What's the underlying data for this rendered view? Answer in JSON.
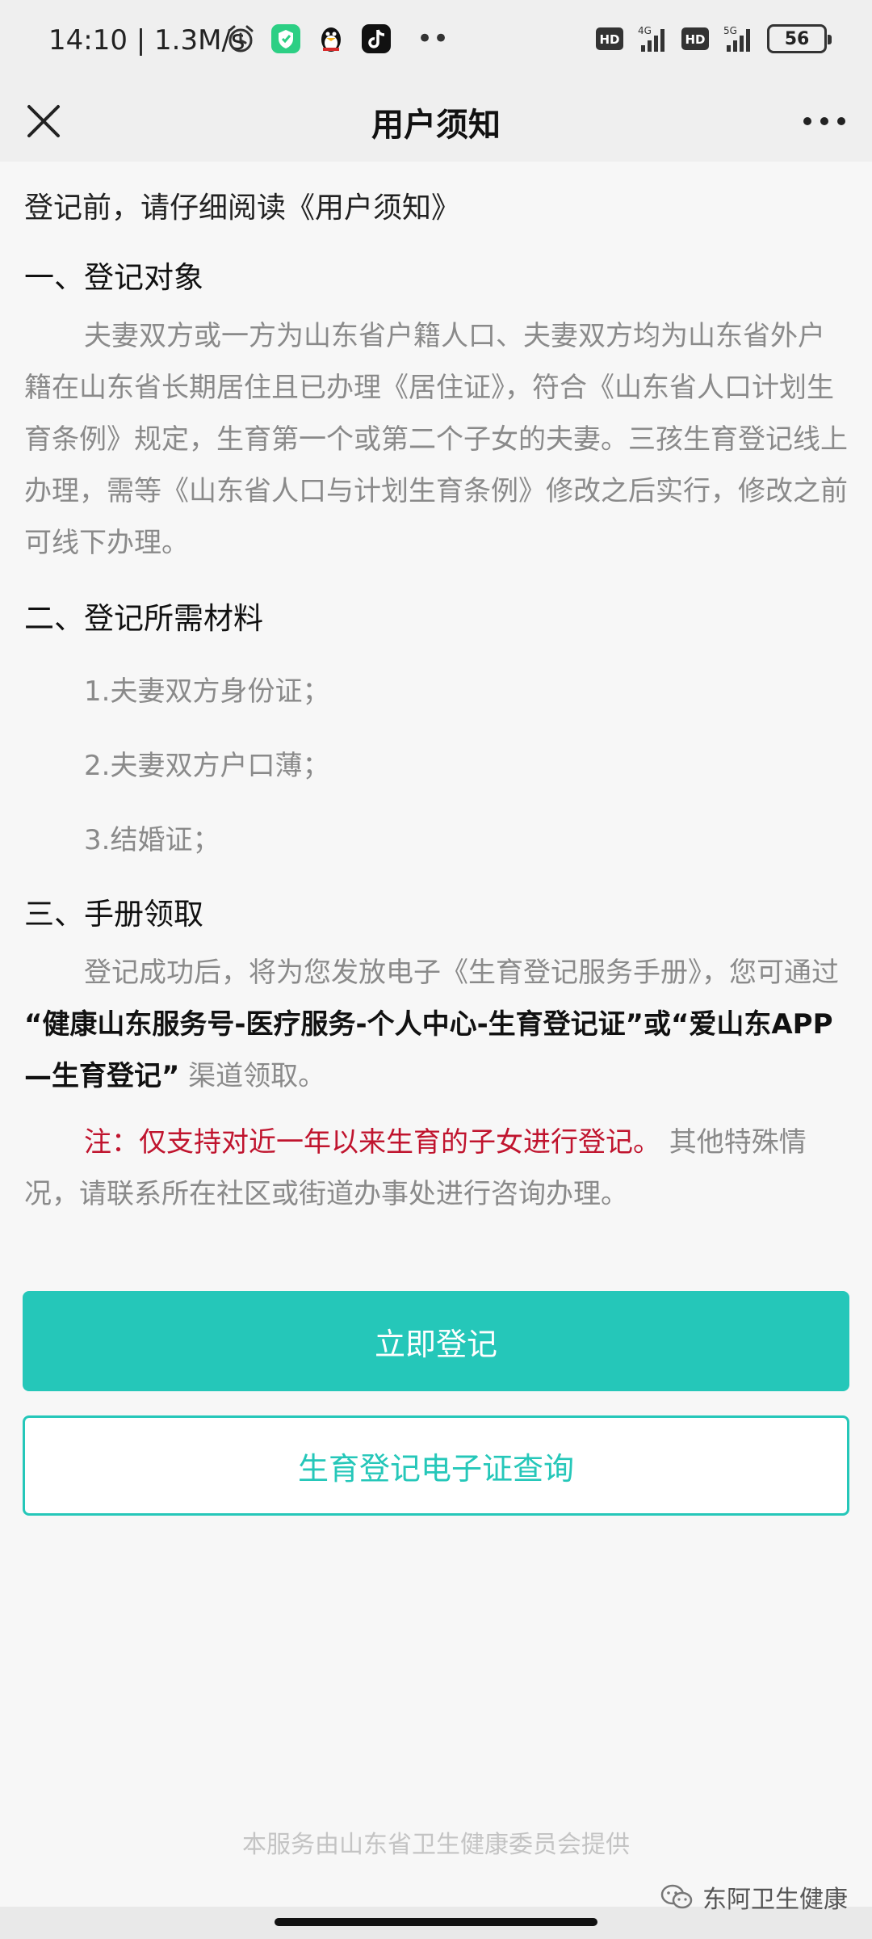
{
  "status_bar": {
    "time": "14:10 | 1.3M/s",
    "battery": "56",
    "hd_label": "HD",
    "net_4g": "4G",
    "net_5g": "5G"
  },
  "nav": {
    "title": "用户须知"
  },
  "content": {
    "intro": "登记前，请仔细阅读《用户须知》",
    "section1_title": "一、登记对象",
    "section1_para": "夫妻双方或一方为山东省户籍人口、夫妻双方均为山东省外户籍在山东省长期居住且已办理《居住证》，符合《山东省人口计划生育条例》规定，生育第一个或第二个子女的夫妻。三孩生育登记线上办理，需等《山东省人口与计划生育条例》修改之后实行，修改之前可线下办理。",
    "section2_title": "二、登记所需材料",
    "materials": [
      "1.夫妻双方身份证；",
      "2.夫妻双方户口薄；",
      "3.结婚证；"
    ],
    "section3_title": "三、手册领取",
    "section3_para_pre": "登记成功后，将为您发放电子《生育登记服务手册》，您可通过 ",
    "section3_para_bold": "“健康山东服务号-医疗服务-个人中心-生育登记证”或“爱山东APP—生育登记”",
    "section3_para_post": " 渠道领取。",
    "note_red": "注：仅支持对近一年以来生育的子女进行登记。",
    "note_rest": " 其他特殊情况，请联系所在社区或街道办事处进行咨询办理。"
  },
  "buttons": {
    "register": "立即登记",
    "query": "生育登记电子证查询"
  },
  "footer": {
    "provider": "本服务由山东省卫生健康委员会提供",
    "watermark": "东阿卫生健康"
  },
  "colors": {
    "accent": "#25c7b9",
    "note_red": "#c0142e",
    "body_gray": "#8a8a8a"
  }
}
